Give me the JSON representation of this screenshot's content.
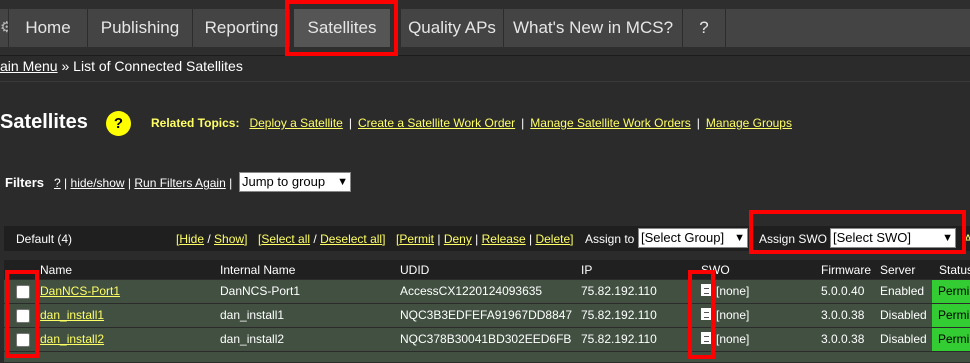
{
  "nav": {
    "gear_icon": "gear-icon",
    "tabs": [
      {
        "label": "Home"
      },
      {
        "label": "Publishing"
      },
      {
        "label": "Reporting"
      },
      {
        "label": "Satellites"
      },
      {
        "label": "Quality APs"
      },
      {
        "label": "What's New in MCS?"
      },
      {
        "label": "?"
      }
    ],
    "active_tab": "Satellites"
  },
  "breadcrumb": {
    "main_menu": "ain Menu",
    "separator": " » ",
    "current": "List of Connected Satellites"
  },
  "page": {
    "title": "Satellites",
    "help": "?",
    "related_label": "Related Topics:",
    "related": [
      {
        "label": "Deploy a Satellite"
      },
      {
        "label": "Create a Satellite Work Order"
      },
      {
        "label": "Manage Satellite Work Orders"
      },
      {
        "label": "Manage Groups"
      }
    ]
  },
  "filters": {
    "label": "Filters",
    "help": "?",
    "hide_show": "hide/show",
    "run_again": "Run Filters Again",
    "sep": "|",
    "jump_select": "Jump to group"
  },
  "toolbar": {
    "group_label": "Default (4)",
    "hide": "Hide",
    "show": "Show",
    "select_all": "Select all",
    "deselect_all": "Deselect all",
    "permit": "Permit",
    "deny": "Deny",
    "release": "Release",
    "delete": "Delete",
    "assign_to_label": "Assign to",
    "assign_to_select": "[Select Group]",
    "assign_swo_label": "Assign SWO",
    "assign_swo_select": "[Select SWO]",
    "trailing": "A"
  },
  "table": {
    "columns": [
      "Name",
      "Internal Name",
      "UDID",
      "IP",
      "SWO",
      "Firmware",
      "Server",
      "Status"
    ],
    "rows": [
      {
        "name": "DanNCS-Port1",
        "internal": "DanNCS-Port1",
        "udid": "AccessCX1220124093635",
        "ip": "75.82.192.110",
        "swo": "[none]",
        "firmware": "5.0.0.40",
        "server": "Enabled",
        "status": "Permi"
      },
      {
        "name": "dan_install1",
        "internal": "dan_install1",
        "udid": "NQC3B3EDFEFA91967DD8847",
        "ip": "75.82.192.110",
        "swo": "[none]",
        "firmware": "3.0.0.38",
        "server": "Disabled",
        "status": "Permi"
      },
      {
        "name": "dan_install2",
        "internal": "dan_install2",
        "udid": "NQC378B30041BD302EED6FB",
        "ip": "75.82.192.110",
        "swo": "[none]",
        "firmware": "3.0.0.38",
        "server": "Disabled",
        "status": "Permi"
      }
    ]
  },
  "colors": {
    "highlight": "#ff0000",
    "link": "#ffff66",
    "row_bg": "#415041",
    "status_green": "#33cc33"
  }
}
